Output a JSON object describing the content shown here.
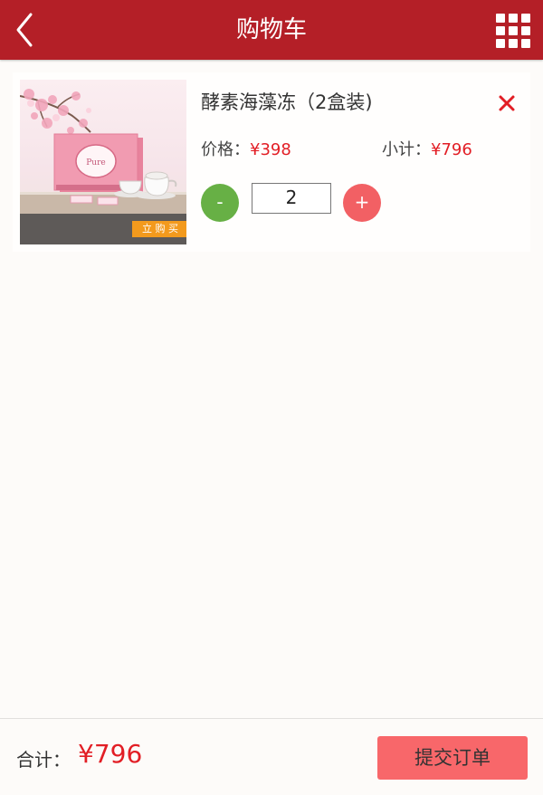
{
  "header": {
    "title": "购物车",
    "back_icon": "chevron-left-icon",
    "menu_icon": "grid-icon"
  },
  "cart": {
    "items": [
      {
        "name": "酵素海藻冻（2盒装)",
        "price_label": "价格：",
        "price": "¥398",
        "subtotal_label": "小计：",
        "subtotal": "¥796",
        "quantity": "2",
        "minus_label": "-",
        "plus_label": "+",
        "delete_icon": "close-icon",
        "image_badge": "立 购 买"
      }
    ]
  },
  "footer": {
    "total_label": "合计：",
    "total_value": "¥796",
    "submit_label": "提交订单"
  },
  "colors": {
    "header_bg": "#b41f27",
    "price": "#e21e25",
    "minus_button": "#67b045",
    "plus_button": "#f26064",
    "submit_button": "#f8676a",
    "image_badge": "#f39a1d"
  }
}
